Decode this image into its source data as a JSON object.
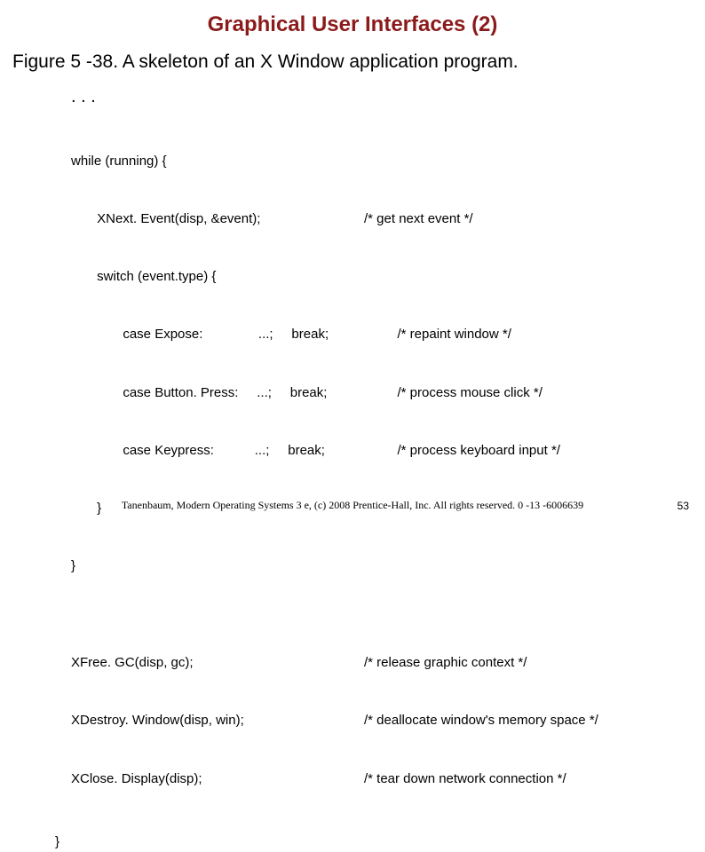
{
  "title": "Graphical User Interfaces (2)",
  "caption": "Figure 5 -38. A skeleton of an X Window application program.",
  "continuation": ". . .",
  "code": {
    "lines": [
      {
        "left": "while (running) {",
        "right": ""
      },
      {
        "left": "       XNext. Event(disp, &event);",
        "right": "/* get next event */"
      },
      {
        "left": "       switch (event.type) {",
        "right": ""
      },
      {
        "left": "              case Expose:               ...;     break;",
        "right": "         /* repaint window */"
      },
      {
        "left": "              case Button. Press:     ...;     break;",
        "right": "         /* process mouse click */"
      },
      {
        "left": "              case Keypress:           ...;     break;",
        "right": "         /* process keyboard input */"
      },
      {
        "left": "       }",
        "right": ""
      },
      {
        "left": "}",
        "right": ""
      },
      {
        "left": "",
        "right": ""
      },
      {
        "left": "XFree. GC(disp, gc);",
        "right": "/* release graphic context */"
      },
      {
        "left": "XDestroy. Window(disp, win);",
        "right": "/* deallocate window's memory space */"
      },
      {
        "left": "XClose. Display(disp);",
        "right": "/* tear down network connection */"
      }
    ],
    "closing": "}"
  },
  "footer": "Tanenbaum, Modern Operating Systems 3 e, (c) 2008 Prentice-Hall, Inc. All rights reserved. 0 -13 -6006639",
  "page_number": "53"
}
